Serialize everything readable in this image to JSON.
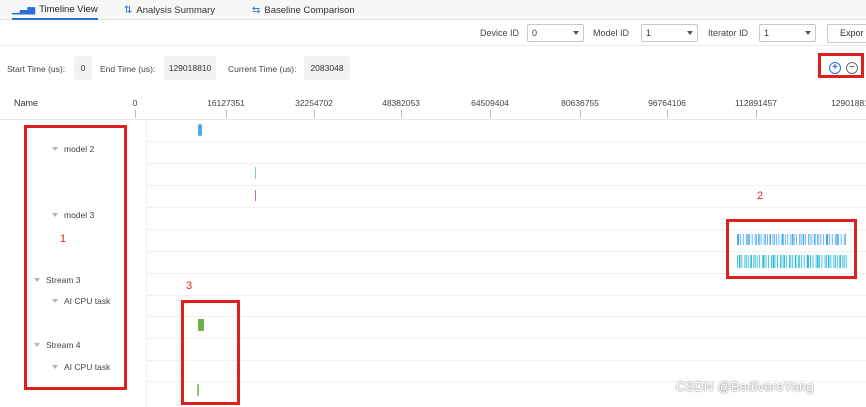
{
  "tabs": [
    {
      "label": "Timeline View",
      "icon": "bar-chart-icon",
      "active": true
    },
    {
      "label": "Analysis Summary",
      "icon": "analysis-icon",
      "active": false
    },
    {
      "label": "Baseline Comparison",
      "icon": "compare-icon",
      "active": false
    }
  ],
  "filters": {
    "device_label": "Device ID",
    "device_value": "0",
    "model_label": "Model ID",
    "model_value": "1",
    "iterator_label": "Iterator ID",
    "iterator_value": "1",
    "export_label": "Expor"
  },
  "time": {
    "start_label": "Start Time (us):",
    "start_value": "0",
    "end_label": "End Time (us):",
    "end_value": "129018810",
    "current_label": "Current Time (us):",
    "current_value": "2083048"
  },
  "zoom": {
    "in_icon": "zoom-in-icon",
    "out_icon": "zoom-out-icon"
  },
  "axis": {
    "name_header": "Name",
    "ticks": [
      "0",
      "16127351",
      "32254702",
      "48382053",
      "64509404",
      "80636755",
      "96764106",
      "112891457",
      "12901881"
    ]
  },
  "tree": [
    {
      "label": "model 2",
      "level": 2
    },
    {
      "label": "model 3",
      "level": 2
    },
    {
      "label": "Stream 3",
      "level": 1
    },
    {
      "label": "AI CPU task",
      "level": 2
    },
    {
      "label": "Stream 4",
      "level": 1
    },
    {
      "label": "AI CPU task",
      "level": 2
    }
  ],
  "annotations": [
    "1",
    "2",
    "3"
  ],
  "colors": {
    "accent": "#2c6fd6",
    "mark_blue": "#4aaaf0",
    "mark_cyan": "#1fb8d8",
    "mark_purple": "#b26ad6",
    "mark_green": "#6ab04c",
    "annotation_red": "#e0201e"
  },
  "watermark": "CSDN @BedivereYang"
}
